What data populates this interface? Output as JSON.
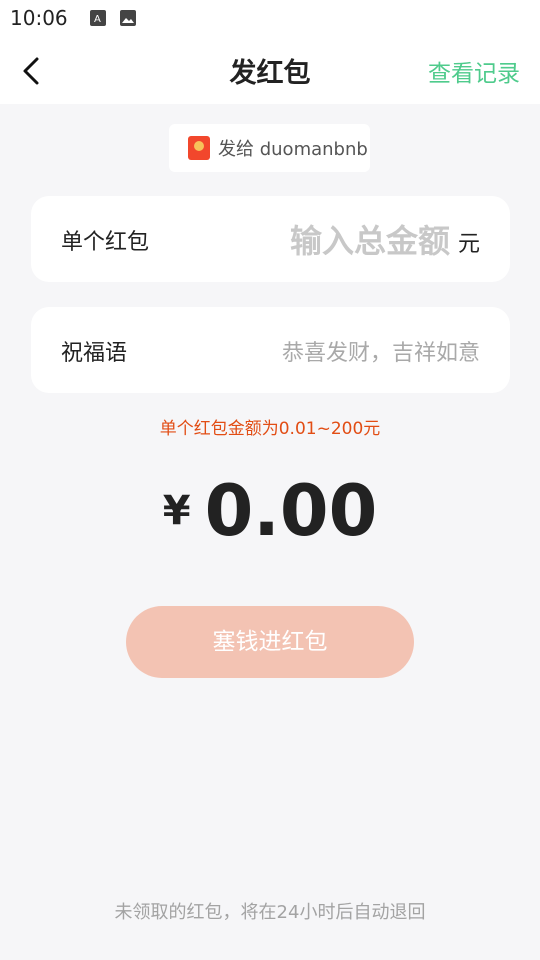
{
  "status_bar": {
    "time": "10:06"
  },
  "header": {
    "title": "发红包",
    "records": "查看记录"
  },
  "recipient": {
    "text": "发给 duomanbnb"
  },
  "amount_card": {
    "label": "单个红包",
    "placeholder": "输入总金额",
    "unit": "元"
  },
  "greeting_card": {
    "label": "祝福语",
    "placeholder": "恭喜发财，吉祥如意"
  },
  "hint": "单个红包金额为0.01~200元",
  "total": {
    "currency": "¥",
    "value": "0.00"
  },
  "submit_label": "塞钱进红包",
  "footer": "未领取的红包，将在24小时后自动退回",
  "colors": {
    "accent_green": "#4fcb8c",
    "hint_red": "#e24d14",
    "button_disabled": "#f3c3b3"
  }
}
